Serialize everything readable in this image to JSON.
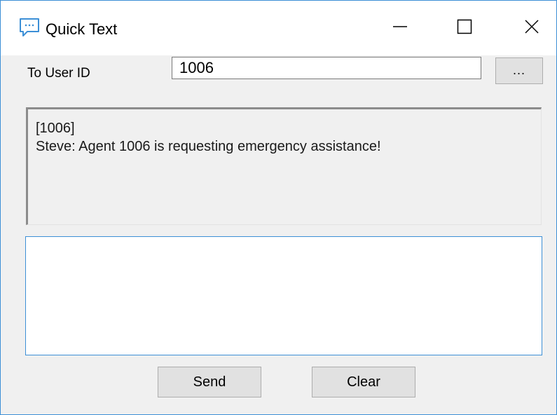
{
  "window": {
    "title": "Quick Text",
    "app_icon": "chat-bubble-icon",
    "controls": {
      "minimize_icon": "minimize-icon",
      "maximize_icon": "maximize-icon",
      "close_icon": "close-icon"
    }
  },
  "form": {
    "to_user_label": "To User ID",
    "to_user_value": "1006",
    "browse_label": "..."
  },
  "history": {
    "lines": [
      "[1006]",
      "Steve: Agent 1006 is requesting emergency assistance!"
    ]
  },
  "compose": {
    "value": ""
  },
  "actions": {
    "send_label": "Send",
    "clear_label": "Clear"
  },
  "colors": {
    "accent": "#3c8fd6",
    "window_bg": "#f0f0f0",
    "button_bg": "#e1e1e1"
  }
}
